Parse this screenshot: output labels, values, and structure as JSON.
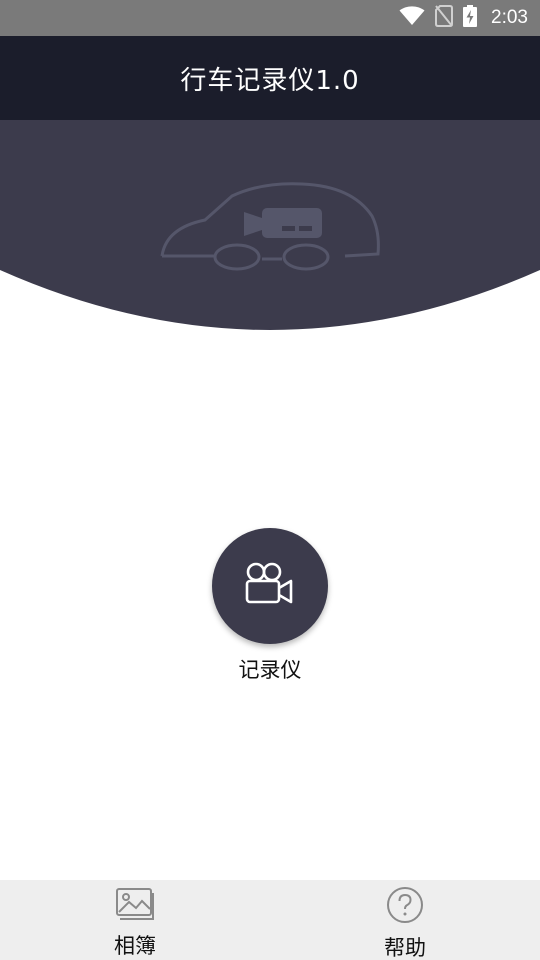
{
  "status_bar": {
    "time": "2:03",
    "icons": [
      "wifi-icon",
      "no-sim-icon",
      "battery-charging-icon"
    ]
  },
  "app_bar": {
    "title": "行车记录仪1.0"
  },
  "hero": {
    "icon": "car-camera-icon",
    "background_color": "#3c3b4c"
  },
  "main": {
    "record_button": {
      "icon": "video-camera-icon",
      "label": "记录仪",
      "color": "#3c3b4c"
    }
  },
  "bottom_nav": {
    "items": [
      {
        "label": "相簿",
        "icon": "image-icon"
      },
      {
        "label": "帮助",
        "icon": "help-icon"
      }
    ]
  },
  "colors": {
    "status_bar": "#7a7a7a",
    "app_bar": "#1b1d2b",
    "accent": "#3c3b4c",
    "nav_background": "#eeeeee"
  }
}
